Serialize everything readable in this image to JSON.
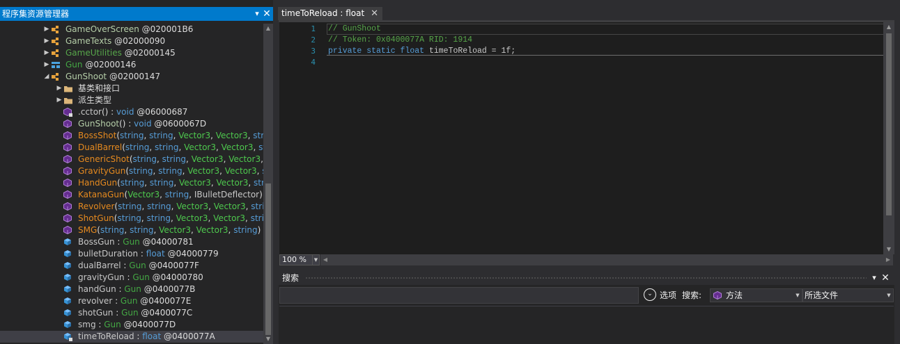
{
  "explorer": {
    "title": "程序集资源管理器",
    "pin_glyph": "▾",
    "close_glyph": "✕",
    "rows": [
      {
        "indent": 62,
        "expander": "▶",
        "icon": "class-icon",
        "parts": [
          {
            "t": "GameOverScreen",
            "c": "c-ok"
          },
          {
            "t": " @020001B6",
            "c": "c-white"
          }
        ]
      },
      {
        "indent": 62,
        "expander": "▶",
        "icon": "class-icon",
        "parts": [
          {
            "t": "GameTexts",
            "c": "c-ok"
          },
          {
            "t": " @02000090",
            "c": "c-white"
          }
        ]
      },
      {
        "indent": 62,
        "expander": "▶",
        "icon": "class-icon",
        "parts": [
          {
            "t": "GameUtilities",
            "c": "c-static"
          },
          {
            "t": " @02000145",
            "c": "c-white"
          }
        ]
      },
      {
        "indent": 62,
        "expander": "▶",
        "icon": "enum-icon",
        "parts": [
          {
            "t": "Gun",
            "c": "c-dgreen"
          },
          {
            "t": " @02000146",
            "c": "c-white"
          }
        ]
      },
      {
        "indent": 62,
        "expander": "◢",
        "icon": "class-icon",
        "parts": [
          {
            "t": "GunShoot",
            "c": "c-ok"
          },
          {
            "t": " @02000147",
            "c": "c-white"
          }
        ]
      },
      {
        "indent": 80,
        "expander": "▶",
        "icon": "folder-icon",
        "parts": [
          {
            "t": "基类和接口",
            "c": "c-white"
          }
        ]
      },
      {
        "indent": 80,
        "expander": "▶",
        "icon": "folder-icon",
        "parts": [
          {
            "t": "派生类型",
            "c": "c-white"
          }
        ]
      },
      {
        "indent": 80,
        "expander": "",
        "icon": "static-method-icon",
        "parts": [
          {
            "t": ".cctor",
            "c": "c-muted"
          },
          {
            "t": "() : ",
            "c": "c-white"
          },
          {
            "t": "void",
            "c": "c-kw"
          },
          {
            "t": " @06000687",
            "c": "c-white"
          }
        ]
      },
      {
        "indent": 80,
        "expander": "",
        "icon": "method-icon",
        "parts": [
          {
            "t": "GunShoot",
            "c": "c-ok"
          },
          {
            "t": "() : ",
            "c": "c-white"
          },
          {
            "t": "void",
            "c": "c-kw"
          },
          {
            "t": " @0600067D",
            "c": "c-white"
          }
        ]
      },
      {
        "indent": 80,
        "expander": "",
        "icon": "method-icon",
        "parts": [
          {
            "t": "BossShot",
            "c": "c-meth"
          },
          {
            "t": "(",
            "c": "c-white"
          },
          {
            "t": "string",
            "c": "c-kw"
          },
          {
            "t": ", ",
            "c": "c-white"
          },
          {
            "t": "string",
            "c": "c-kw"
          },
          {
            "t": ", ",
            "c": "c-white"
          },
          {
            "t": "Vector3",
            "c": "c-green"
          },
          {
            "t": ", ",
            "c": "c-white"
          },
          {
            "t": "Vector3",
            "c": "c-green"
          },
          {
            "t": ", ",
            "c": "c-white"
          },
          {
            "t": "strin",
            "c": "c-kw"
          }
        ]
      },
      {
        "indent": 80,
        "expander": "",
        "icon": "method-icon",
        "parts": [
          {
            "t": "DualBarrel",
            "c": "c-meth"
          },
          {
            "t": "(",
            "c": "c-white"
          },
          {
            "t": "string",
            "c": "c-kw"
          },
          {
            "t": ", ",
            "c": "c-white"
          },
          {
            "t": "string",
            "c": "c-kw"
          },
          {
            "t": ", ",
            "c": "c-white"
          },
          {
            "t": "Vector3",
            "c": "c-green"
          },
          {
            "t": ", ",
            "c": "c-white"
          },
          {
            "t": "Vector3",
            "c": "c-green"
          },
          {
            "t": ", ",
            "c": "c-white"
          },
          {
            "t": "str",
            "c": "c-kw"
          }
        ]
      },
      {
        "indent": 80,
        "expander": "",
        "icon": "method-icon",
        "parts": [
          {
            "t": "GenericShot",
            "c": "c-meth"
          },
          {
            "t": "(",
            "c": "c-white"
          },
          {
            "t": "string",
            "c": "c-kw"
          },
          {
            "t": ", ",
            "c": "c-white"
          },
          {
            "t": "string",
            "c": "c-kw"
          },
          {
            "t": ", ",
            "c": "c-white"
          },
          {
            "t": "Vector3",
            "c": "c-green"
          },
          {
            "t": ", ",
            "c": "c-white"
          },
          {
            "t": "Vector3",
            "c": "c-green"
          },
          {
            "t": ", ",
            "c": "c-white"
          },
          {
            "t": "s",
            "c": "c-kw"
          }
        ]
      },
      {
        "indent": 80,
        "expander": "",
        "icon": "method-icon",
        "parts": [
          {
            "t": "GravityGun",
            "c": "c-meth"
          },
          {
            "t": "(",
            "c": "c-white"
          },
          {
            "t": "string",
            "c": "c-kw"
          },
          {
            "t": ", ",
            "c": "c-white"
          },
          {
            "t": "string",
            "c": "c-kw"
          },
          {
            "t": ", ",
            "c": "c-white"
          },
          {
            "t": "Vector3",
            "c": "c-green"
          },
          {
            "t": ", ",
            "c": "c-white"
          },
          {
            "t": "Vector3",
            "c": "c-green"
          },
          {
            "t": ", ",
            "c": "c-white"
          },
          {
            "t": "st",
            "c": "c-kw"
          }
        ]
      },
      {
        "indent": 80,
        "expander": "",
        "icon": "method-icon",
        "parts": [
          {
            "t": "HandGun",
            "c": "c-meth"
          },
          {
            "t": "(",
            "c": "c-white"
          },
          {
            "t": "string",
            "c": "c-kw"
          },
          {
            "t": ", ",
            "c": "c-white"
          },
          {
            "t": "string",
            "c": "c-kw"
          },
          {
            "t": ", ",
            "c": "c-white"
          },
          {
            "t": "Vector3",
            "c": "c-green"
          },
          {
            "t": ", ",
            "c": "c-white"
          },
          {
            "t": "Vector3",
            "c": "c-green"
          },
          {
            "t": ", ",
            "c": "c-white"
          },
          {
            "t": "strin",
            "c": "c-kw"
          }
        ]
      },
      {
        "indent": 80,
        "expander": "",
        "icon": "method-icon",
        "parts": [
          {
            "t": "KatanaGun",
            "c": "c-meth"
          },
          {
            "t": "(",
            "c": "c-white"
          },
          {
            "t": "Vector3",
            "c": "c-green"
          },
          {
            "t": ", ",
            "c": "c-white"
          },
          {
            "t": "string",
            "c": "c-kw"
          },
          {
            "t": ", ",
            "c": "c-white"
          },
          {
            "t": "IBulletDeflector",
            "c": "c-muted"
          },
          {
            "t": ") :",
            "c": "c-white"
          }
        ]
      },
      {
        "indent": 80,
        "expander": "",
        "icon": "method-icon",
        "parts": [
          {
            "t": "Revolver",
            "c": "c-meth"
          },
          {
            "t": "(",
            "c": "c-white"
          },
          {
            "t": "string",
            "c": "c-kw"
          },
          {
            "t": ", ",
            "c": "c-white"
          },
          {
            "t": "string",
            "c": "c-kw"
          },
          {
            "t": ", ",
            "c": "c-white"
          },
          {
            "t": "Vector3",
            "c": "c-green"
          },
          {
            "t": ", ",
            "c": "c-white"
          },
          {
            "t": "Vector3",
            "c": "c-green"
          },
          {
            "t": ", ",
            "c": "c-white"
          },
          {
            "t": "strin",
            "c": "c-kw"
          }
        ]
      },
      {
        "indent": 80,
        "expander": "",
        "icon": "method-icon",
        "parts": [
          {
            "t": "ShotGun",
            "c": "c-meth"
          },
          {
            "t": "(",
            "c": "c-white"
          },
          {
            "t": "string",
            "c": "c-kw"
          },
          {
            "t": ", ",
            "c": "c-white"
          },
          {
            "t": "string",
            "c": "c-kw"
          },
          {
            "t": ", ",
            "c": "c-white"
          },
          {
            "t": "Vector3",
            "c": "c-green"
          },
          {
            "t": ", ",
            "c": "c-white"
          },
          {
            "t": "Vector3",
            "c": "c-green"
          },
          {
            "t": ", ",
            "c": "c-white"
          },
          {
            "t": "strin",
            "c": "c-kw"
          }
        ]
      },
      {
        "indent": 80,
        "expander": "",
        "icon": "method-icon",
        "parts": [
          {
            "t": "SMG",
            "c": "c-meth"
          },
          {
            "t": "(",
            "c": "c-white"
          },
          {
            "t": "string",
            "c": "c-kw"
          },
          {
            "t": ", ",
            "c": "c-white"
          },
          {
            "t": "string",
            "c": "c-kw"
          },
          {
            "t": ", ",
            "c": "c-white"
          },
          {
            "t": "Vector3",
            "c": "c-green"
          },
          {
            "t": ", ",
            "c": "c-white"
          },
          {
            "t": "Vector3",
            "c": "c-green"
          },
          {
            "t": ", ",
            "c": "c-white"
          },
          {
            "t": "string",
            "c": "c-kw"
          },
          {
            "t": ") :",
            "c": "c-white"
          }
        ]
      },
      {
        "indent": 80,
        "expander": "",
        "icon": "field-icon",
        "parts": [
          {
            "t": "BossGun",
            "c": "c-muted"
          },
          {
            "t": " : ",
            "c": "c-white"
          },
          {
            "t": "Gun",
            "c": "c-dgreen"
          },
          {
            "t": " @04000781",
            "c": "c-white"
          }
        ]
      },
      {
        "indent": 80,
        "expander": "",
        "icon": "field-icon",
        "parts": [
          {
            "t": "bulletDuration",
            "c": "c-muted"
          },
          {
            "t": " : ",
            "c": "c-white"
          },
          {
            "t": "float",
            "c": "c-kw"
          },
          {
            "t": " @04000779",
            "c": "c-white"
          }
        ]
      },
      {
        "indent": 80,
        "expander": "",
        "icon": "field-icon",
        "parts": [
          {
            "t": "dualBarrel",
            "c": "c-muted"
          },
          {
            "t": " : ",
            "c": "c-white"
          },
          {
            "t": "Gun",
            "c": "c-dgreen"
          },
          {
            "t": " @0400077F",
            "c": "c-white"
          }
        ]
      },
      {
        "indent": 80,
        "expander": "",
        "icon": "field-icon",
        "parts": [
          {
            "t": "gravityGun",
            "c": "c-muted"
          },
          {
            "t": " : ",
            "c": "c-white"
          },
          {
            "t": "Gun",
            "c": "c-dgreen"
          },
          {
            "t": " @04000780",
            "c": "c-white"
          }
        ]
      },
      {
        "indent": 80,
        "expander": "",
        "icon": "field-icon",
        "parts": [
          {
            "t": "handGun",
            "c": "c-muted"
          },
          {
            "t": " : ",
            "c": "c-white"
          },
          {
            "t": "Gun",
            "c": "c-dgreen"
          },
          {
            "t": " @0400077B",
            "c": "c-white"
          }
        ]
      },
      {
        "indent": 80,
        "expander": "",
        "icon": "field-icon",
        "parts": [
          {
            "t": "revolver",
            "c": "c-muted"
          },
          {
            "t": " : ",
            "c": "c-white"
          },
          {
            "t": "Gun",
            "c": "c-dgreen"
          },
          {
            "t": " @0400077E",
            "c": "c-white"
          }
        ]
      },
      {
        "indent": 80,
        "expander": "",
        "icon": "field-icon",
        "parts": [
          {
            "t": "shotGun",
            "c": "c-muted"
          },
          {
            "t": " : ",
            "c": "c-white"
          },
          {
            "t": "Gun",
            "c": "c-dgreen"
          },
          {
            "t": " @0400077C",
            "c": "c-white"
          }
        ]
      },
      {
        "indent": 80,
        "expander": "",
        "icon": "field-icon",
        "parts": [
          {
            "t": "smg",
            "c": "c-muted"
          },
          {
            "t": " : ",
            "c": "c-white"
          },
          {
            "t": "Gun",
            "c": "c-dgreen"
          },
          {
            "t": " @0400077D",
            "c": "c-white"
          }
        ]
      },
      {
        "indent": 80,
        "expander": "",
        "icon": "static-field-icon",
        "selected": true,
        "parts": [
          {
            "t": "timeToReload",
            "c": "c-muted"
          },
          {
            "t": " : ",
            "c": "c-white"
          },
          {
            "t": "float",
            "c": "c-kw"
          },
          {
            "t": " @0400077A",
            "c": "c-white"
          }
        ]
      }
    ]
  },
  "editor": {
    "tab_label": "timeToReload : float",
    "tab_close": "✕",
    "line_numbers": [
      "1",
      "2",
      "3",
      "4"
    ],
    "lines": [
      [
        {
          "t": "// GunShoot",
          "c": "cm"
        }
      ],
      [
        {
          "t": "// Token: 0x0400077A RID: 1914",
          "c": "cm"
        }
      ],
      [
        {
          "t": "private",
          "c": "kw"
        },
        {
          "t": " ",
          "c": "id"
        },
        {
          "t": "static",
          "c": "kw"
        },
        {
          "t": " ",
          "c": "id"
        },
        {
          "t": "float",
          "c": "kw"
        },
        {
          "t": " timeToReload = 1f;",
          "c": "id"
        }
      ],
      []
    ],
    "zoom": "100 %"
  },
  "search": {
    "title": "搜索",
    "input_value": "",
    "options_label": "选项",
    "search_label": "搜索:",
    "type_value": "方法",
    "scope_value": "所选文件"
  },
  "colors": {
    "accent": "#007acc",
    "background": "#252526",
    "editor_bg": "#1e1e1e"
  }
}
